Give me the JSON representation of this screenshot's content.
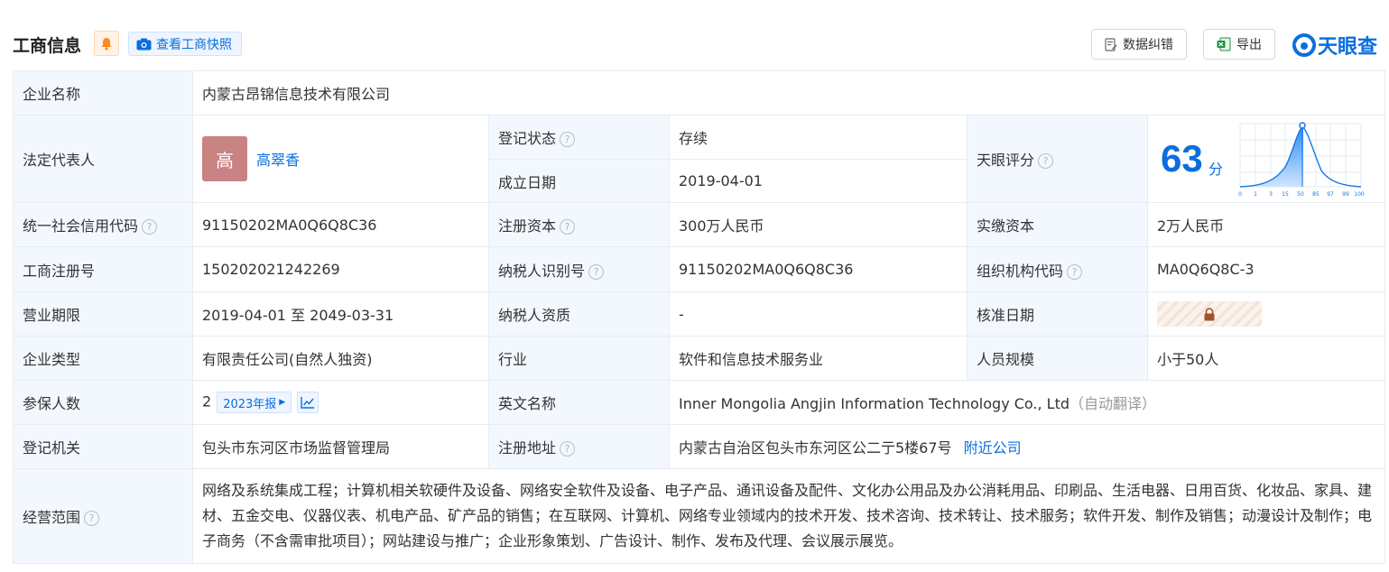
{
  "header": {
    "title": "工商信息",
    "snapshot_label": "查看工商快照",
    "fix_label": "数据纠错",
    "export_label": "导出",
    "logo_text": "天眼查",
    "accent_color": "#0a6ee0"
  },
  "company": {
    "name_label": "企业名称",
    "name": "内蒙古昂锦信息技术有限公司",
    "rep_label": "法定代表人",
    "rep_avatar": "高",
    "rep_name": "高翠香",
    "status_label": "登记状态",
    "status": "存续",
    "founded_label": "成立日期",
    "founded": "2019-04-01",
    "score_label": "天眼评分",
    "score": "63",
    "score_unit": "分",
    "score_ticks": [
      "0",
      "1",
      "3",
      "15",
      "50",
      "85",
      "97",
      "99",
      "100"
    ],
    "credit_label": "统一社会信用代码",
    "credit": "91150202MA0Q6Q8C36",
    "reg_capital_label": "注册资本",
    "reg_capital": "300万人民币",
    "paid_capital_label": "实缴资本",
    "paid_capital": "2万人民币",
    "reg_no_label": "工商注册号",
    "reg_no": "150202021242269",
    "taxpayer_id_label": "纳税人识别号",
    "taxpayer_id": "91150202MA0Q6Q8C36",
    "org_code_label": "组织机构代码",
    "org_code": "MA0Q6Q8C-3",
    "period_label": "营业期限",
    "period": "2019-04-01 至 2049-03-31",
    "taxpayer_qual_label": "纳税人资质",
    "taxpayer_qual": "-",
    "approve_label": "核准日期",
    "type_label": "企业类型",
    "type": "有限责任公司(自然人独资)",
    "industry_label": "行业",
    "industry": "软件和信息技术服务业",
    "staff_label": "人员规模",
    "staff": "小于50人",
    "insured_label": "参保人数",
    "insured": "2",
    "insured_year": "2023年报",
    "en_name_label": "英文名称",
    "en_name": "Inner Mongolia Angjin Information Technology Co., Ltd",
    "en_name_note": "（自动翻译）",
    "authority_label": "登记机关",
    "authority": "包头市东河区市场监督管理局",
    "address_label": "注册地址",
    "address": "内蒙古自治区包头市东河区公二亍5楼67号",
    "nearby_label": "附近公司",
    "scope_label": "经营范围",
    "scope": "网络及系统集成工程；计算机相关软硬件及设备、网络安全软件及设备、电子产品、通讯设备及配件、文化办公用品及办公消耗用品、印刷品、生活电器、日用百货、化妆品、家具、建材、五金交电、仪器仪表、机电产品、矿产品的销售；在互联网、计算机、网络专业领域内的技术开发、技术咨询、技术转让、技术服务；软件开发、制作及销售；动漫设计及制作；电子商务（不含需审批项目）；网站建设与推广；企业形象策划、广告设计、制作、发布及代理、会议展示展览。"
  }
}
